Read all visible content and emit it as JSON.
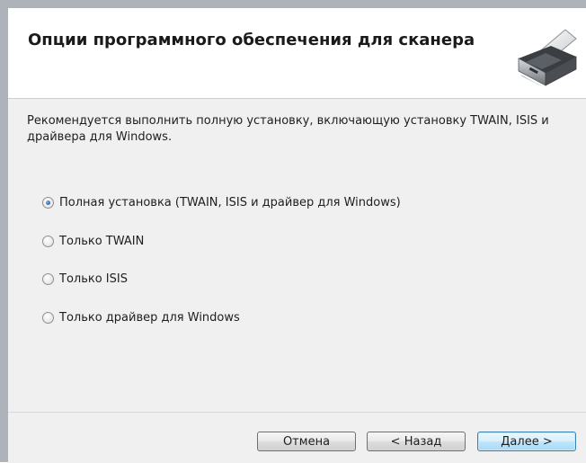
{
  "header": {
    "title": "Опции программного обеспечения для сканера",
    "icon": "scanner-icon"
  },
  "content": {
    "description": "Рекомендуется выполнить полную установку, включающую установку TWAIN, ISIS и драйвера для Windows.",
    "options": [
      {
        "label": "Полная установка (TWAIN, ISIS и драйвер для Windows)",
        "selected": true
      },
      {
        "label": "Только TWAIN",
        "selected": false
      },
      {
        "label": "Только ISIS",
        "selected": false
      },
      {
        "label": "Только драйвер для Windows",
        "selected": false
      }
    ]
  },
  "footer": {
    "cancel_label": "Отмена",
    "back_label": "< Назад",
    "next_label": "Далее >"
  },
  "colors": {
    "window_border": "#aeb3b9",
    "content_bg": "#f0f0f0",
    "primary_button_border": "#3c7fb1",
    "radio_selected": "#2a63b8"
  }
}
